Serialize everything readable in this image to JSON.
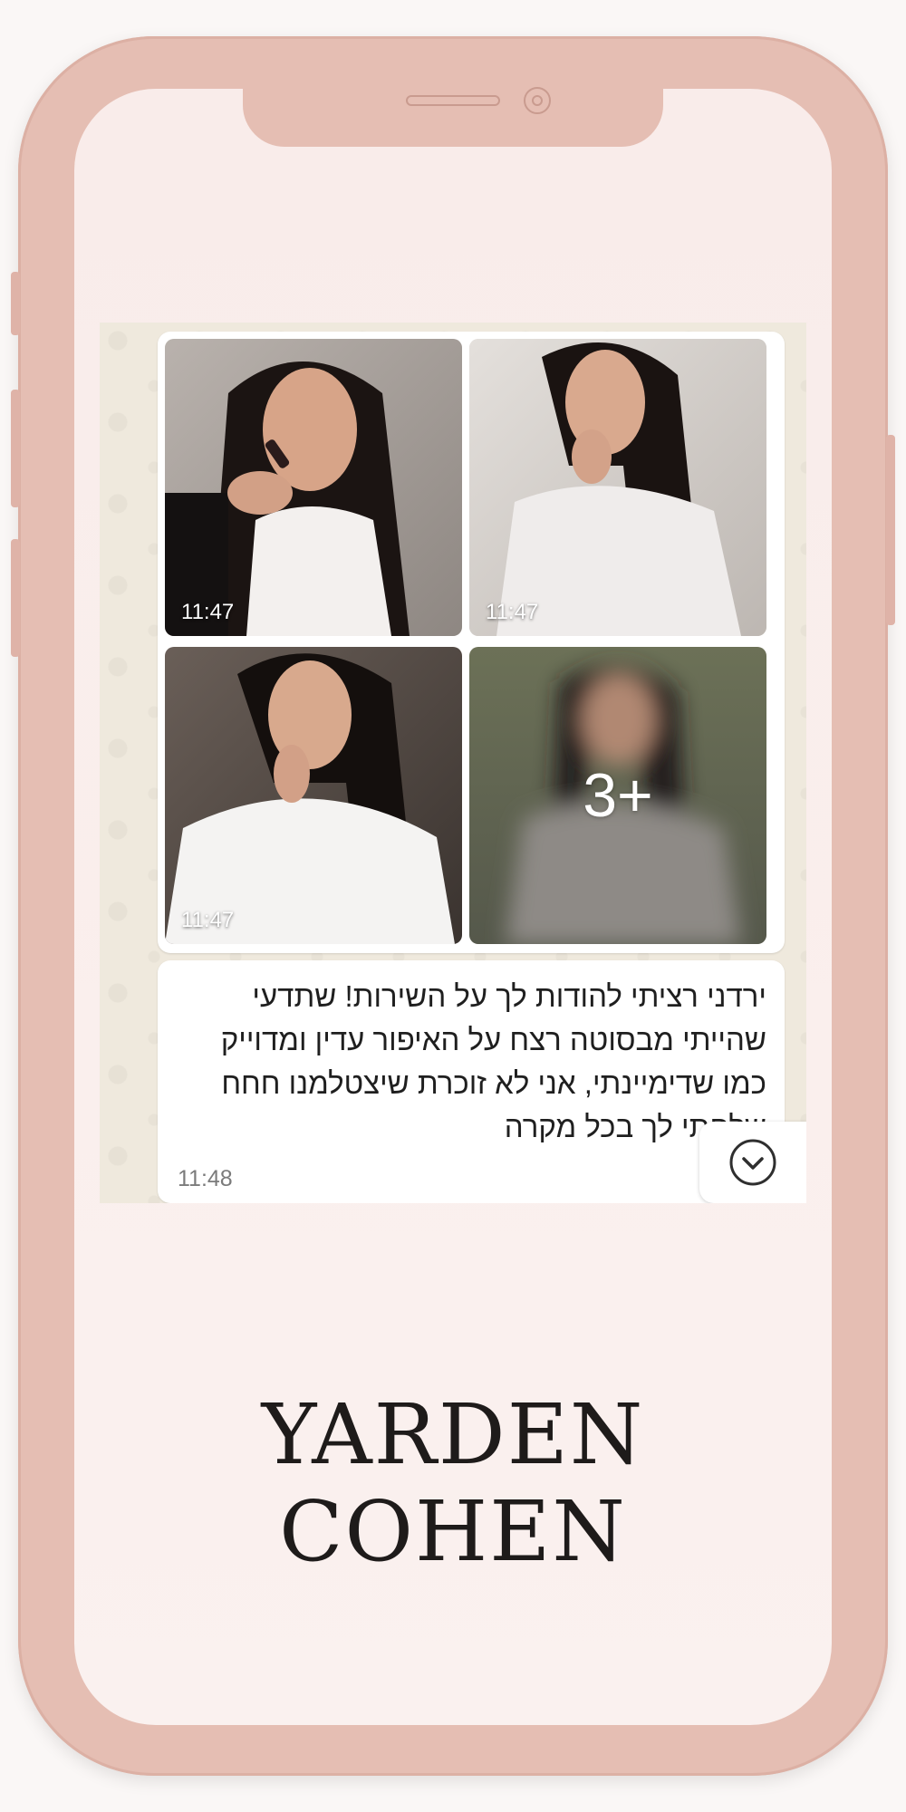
{
  "chat": {
    "photos": [
      {
        "time": "11:47"
      },
      {
        "time": "11:47"
      },
      {
        "time": "11:47"
      },
      {
        "more_count": "3+"
      }
    ],
    "message": {
      "text": "ירדני רציתי להודות לך על השירות! שתדעי שהייתי מבסוטה רצח על האיפור עדין ומדוייק כמו שדימיינתי, אני לא זוכרת שיצטלמנו חחח שלחתי לך בכל מקרה",
      "time": "11:48"
    },
    "scroll_icon": "chevron-down-icon"
  },
  "brand": {
    "name": "YARDEN COHEN"
  },
  "colors": {
    "phone_frame": "#e5beb3",
    "screen": "#f9ecea",
    "chat_bg": "#efe9dd",
    "bubble": "#ffffff"
  }
}
